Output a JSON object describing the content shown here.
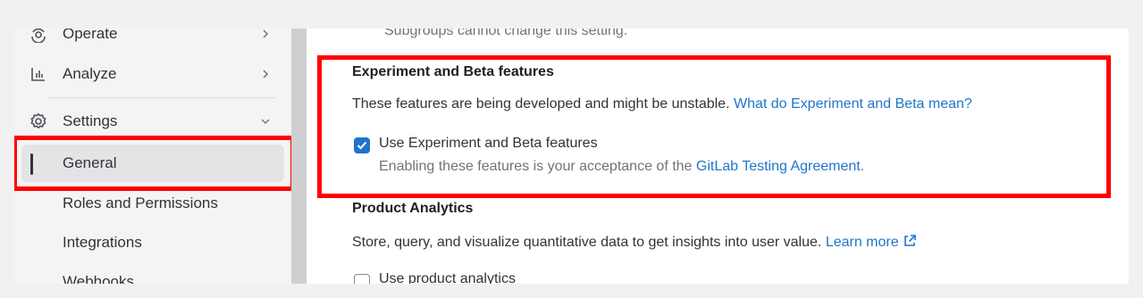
{
  "sidebar": {
    "items": [
      {
        "label": "Operate",
        "icon": "deployments-icon",
        "chevron": "chevron-right"
      },
      {
        "label": "Analyze",
        "icon": "chart-icon",
        "chevron": "chevron-right"
      },
      {
        "label": "Settings",
        "icon": "settings-icon",
        "chevron": "chevron-down"
      }
    ],
    "subitems": [
      {
        "label": "General",
        "active": true
      },
      {
        "label": "Roles and Permissions"
      },
      {
        "label": "Integrations"
      },
      {
        "label": "Webhooks"
      }
    ]
  },
  "main": {
    "top_cut_text": "Subgroups cannot change this setting.",
    "experiment": {
      "title": "Experiment and Beta features",
      "description": "These features are being developed and might be unstable.",
      "description_link": "What do Experiment and Beta mean?",
      "checkbox_label": "Use Experiment and Beta features",
      "checkbox_checked": true,
      "help_text": "Enabling these features is your acceptance of the",
      "help_link": "GitLab Testing Agreement",
      "help_suffix": "."
    },
    "analytics": {
      "title": "Product Analytics",
      "description": "Store, query, and visualize quantitative data to get insights into user value.",
      "learn_more": "Learn more",
      "checkbox_label": "Use product analytics",
      "checkbox_checked": false
    }
  },
  "colors": {
    "highlight": "#ff0000",
    "link": "#1f75cb",
    "checkbox": "#1f75cb"
  }
}
